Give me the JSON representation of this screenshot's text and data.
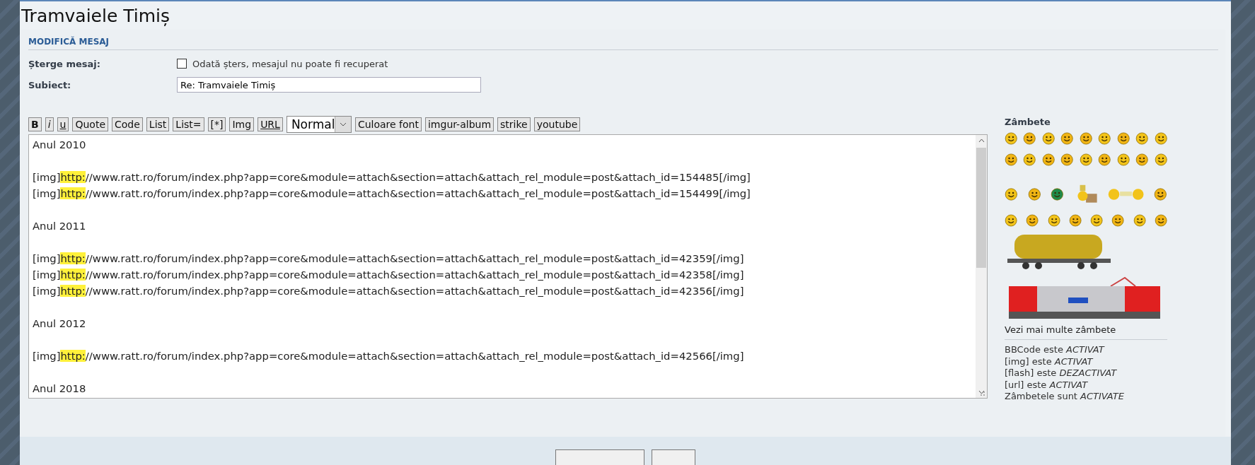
{
  "page_title": "Tramvaiele Timiș",
  "section_title": "MODIFICĂ MESAJ",
  "delete_row": {
    "label": "Șterge mesaj:",
    "checkbox_label": "Odată șters, mesajul nu poate fi recuperat",
    "checked": false
  },
  "subject_row": {
    "label": "Subiect:",
    "value": "Re: Tramvaiele Timiș"
  },
  "toolbar": [
    {
      "kind": "bold",
      "label": "B"
    },
    {
      "kind": "italic",
      "label": "i"
    },
    {
      "kind": "underline",
      "label": "u"
    },
    {
      "kind": "button",
      "label": "Quote"
    },
    {
      "kind": "button",
      "label": "Code"
    },
    {
      "kind": "button",
      "label": "List"
    },
    {
      "kind": "button",
      "label": "List="
    },
    {
      "kind": "button",
      "label": "[*]"
    },
    {
      "kind": "button",
      "label": "Img"
    },
    {
      "kind": "underline",
      "label": "URL"
    },
    {
      "kind": "select",
      "label": "Normal"
    },
    {
      "kind": "button",
      "label": "Culoare font"
    },
    {
      "kind": "button",
      "label": "imgur-album"
    },
    {
      "kind": "button",
      "label": "strike"
    },
    {
      "kind": "button",
      "label": "youtube"
    }
  ],
  "editor_blocks": [
    {
      "lines": [
        {
          "text": "Anul 2010"
        }
      ]
    },
    {
      "lines": [
        {
          "before": "[img]",
          "highlight": "http:",
          "after": "//www.ratt.ro/forum/index.php?app=core&module=attach&section=attach&attach_rel_module=post&attach_id=154485[/img]"
        },
        {
          "before": "[img]",
          "highlight": "http:",
          "after": "//www.ratt.ro/forum/index.php?app=core&module=attach&section=attach&attach_rel_module=post&attach_id=154499[/img]"
        }
      ]
    },
    {
      "lines": [
        {
          "text": "Anul 2011"
        }
      ]
    },
    {
      "lines": [
        {
          "before": "[img]",
          "highlight": "http:",
          "after": "//www.ratt.ro/forum/index.php?app=core&module=attach&section=attach&attach_rel_module=post&attach_id=42359[/img]"
        },
        {
          "before": "[img]",
          "highlight": "http:",
          "after": "//www.ratt.ro/forum/index.php?app=core&module=attach&section=attach&attach_rel_module=post&attach_id=42358[/img]"
        },
        {
          "before": "[img]",
          "highlight": "http:",
          "after": "//www.ratt.ro/forum/index.php?app=core&module=attach&section=attach&attach_rel_module=post&attach_id=42356[/img]"
        }
      ]
    },
    {
      "lines": [
        {
          "text": "Anul 2012"
        }
      ]
    },
    {
      "lines": [
        {
          "before": "[img]",
          "highlight": "http:",
          "after": "//www.ratt.ro/forum/index.php?app=core&module=attach&section=attach&attach_rel_module=post&attach_id=42566[/img]"
        }
      ]
    },
    {
      "lines": [
        {
          "text": "Anul 2018"
        }
      ]
    }
  ],
  "smileys_title": "Zâmbete",
  "more_smileys_link": "Vezi mai multe zâmbete",
  "options": [
    "BBCode este *ACTIVAT*",
    "[img] este *ACTIVAT*",
    "[flash] este *DEZACTIVAT*",
    "[url] este *ACTIVAT*",
    "Zâmbetele sunt *ACTIVATE*"
  ]
}
